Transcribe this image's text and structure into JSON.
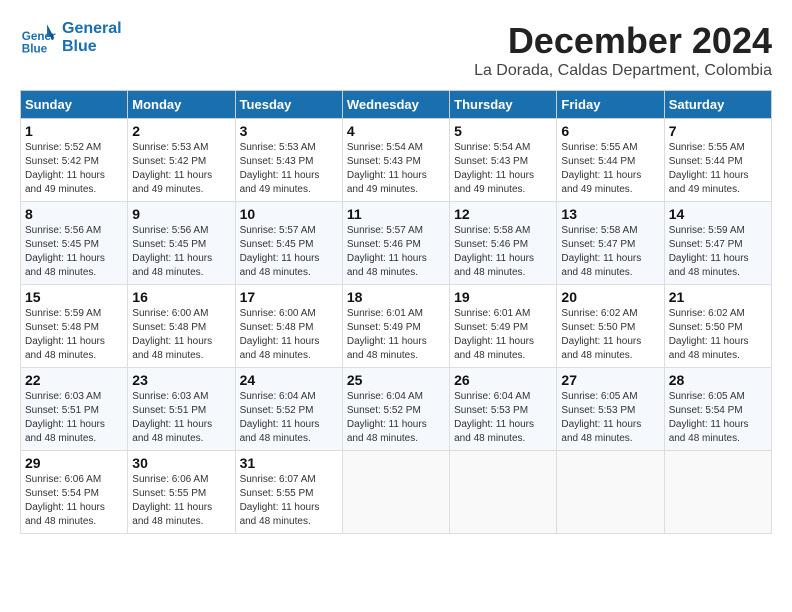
{
  "header": {
    "logo_line1": "General",
    "logo_line2": "Blue",
    "month": "December 2024",
    "location": "La Dorada, Caldas Department, Colombia"
  },
  "weekdays": [
    "Sunday",
    "Monday",
    "Tuesday",
    "Wednesday",
    "Thursday",
    "Friday",
    "Saturday"
  ],
  "weeks": [
    [
      {
        "day": "1",
        "sunrise": "5:52 AM",
        "sunset": "5:42 PM",
        "daylight": "11 hours and 49 minutes."
      },
      {
        "day": "2",
        "sunrise": "5:53 AM",
        "sunset": "5:42 PM",
        "daylight": "11 hours and 49 minutes."
      },
      {
        "day": "3",
        "sunrise": "5:53 AM",
        "sunset": "5:43 PM",
        "daylight": "11 hours and 49 minutes."
      },
      {
        "day": "4",
        "sunrise": "5:54 AM",
        "sunset": "5:43 PM",
        "daylight": "11 hours and 49 minutes."
      },
      {
        "day": "5",
        "sunrise": "5:54 AM",
        "sunset": "5:43 PM",
        "daylight": "11 hours and 49 minutes."
      },
      {
        "day": "6",
        "sunrise": "5:55 AM",
        "sunset": "5:44 PM",
        "daylight": "11 hours and 49 minutes."
      },
      {
        "day": "7",
        "sunrise": "5:55 AM",
        "sunset": "5:44 PM",
        "daylight": "11 hours and 49 minutes."
      }
    ],
    [
      {
        "day": "8",
        "sunrise": "5:56 AM",
        "sunset": "5:45 PM",
        "daylight": "11 hours and 48 minutes."
      },
      {
        "day": "9",
        "sunrise": "5:56 AM",
        "sunset": "5:45 PM",
        "daylight": "11 hours and 48 minutes."
      },
      {
        "day": "10",
        "sunrise": "5:57 AM",
        "sunset": "5:45 PM",
        "daylight": "11 hours and 48 minutes."
      },
      {
        "day": "11",
        "sunrise": "5:57 AM",
        "sunset": "5:46 PM",
        "daylight": "11 hours and 48 minutes."
      },
      {
        "day": "12",
        "sunrise": "5:58 AM",
        "sunset": "5:46 PM",
        "daylight": "11 hours and 48 minutes."
      },
      {
        "day": "13",
        "sunrise": "5:58 AM",
        "sunset": "5:47 PM",
        "daylight": "11 hours and 48 minutes."
      },
      {
        "day": "14",
        "sunrise": "5:59 AM",
        "sunset": "5:47 PM",
        "daylight": "11 hours and 48 minutes."
      }
    ],
    [
      {
        "day": "15",
        "sunrise": "5:59 AM",
        "sunset": "5:48 PM",
        "daylight": "11 hours and 48 minutes."
      },
      {
        "day": "16",
        "sunrise": "6:00 AM",
        "sunset": "5:48 PM",
        "daylight": "11 hours and 48 minutes."
      },
      {
        "day": "17",
        "sunrise": "6:00 AM",
        "sunset": "5:48 PM",
        "daylight": "11 hours and 48 minutes."
      },
      {
        "day": "18",
        "sunrise": "6:01 AM",
        "sunset": "5:49 PM",
        "daylight": "11 hours and 48 minutes."
      },
      {
        "day": "19",
        "sunrise": "6:01 AM",
        "sunset": "5:49 PM",
        "daylight": "11 hours and 48 minutes."
      },
      {
        "day": "20",
        "sunrise": "6:02 AM",
        "sunset": "5:50 PM",
        "daylight": "11 hours and 48 minutes."
      },
      {
        "day": "21",
        "sunrise": "6:02 AM",
        "sunset": "5:50 PM",
        "daylight": "11 hours and 48 minutes."
      }
    ],
    [
      {
        "day": "22",
        "sunrise": "6:03 AM",
        "sunset": "5:51 PM",
        "daylight": "11 hours and 48 minutes."
      },
      {
        "day": "23",
        "sunrise": "6:03 AM",
        "sunset": "5:51 PM",
        "daylight": "11 hours and 48 minutes."
      },
      {
        "day": "24",
        "sunrise": "6:04 AM",
        "sunset": "5:52 PM",
        "daylight": "11 hours and 48 minutes."
      },
      {
        "day": "25",
        "sunrise": "6:04 AM",
        "sunset": "5:52 PM",
        "daylight": "11 hours and 48 minutes."
      },
      {
        "day": "26",
        "sunrise": "6:04 AM",
        "sunset": "5:53 PM",
        "daylight": "11 hours and 48 minutes."
      },
      {
        "day": "27",
        "sunrise": "6:05 AM",
        "sunset": "5:53 PM",
        "daylight": "11 hours and 48 minutes."
      },
      {
        "day": "28",
        "sunrise": "6:05 AM",
        "sunset": "5:54 PM",
        "daylight": "11 hours and 48 minutes."
      }
    ],
    [
      {
        "day": "29",
        "sunrise": "6:06 AM",
        "sunset": "5:54 PM",
        "daylight": "11 hours and 48 minutes."
      },
      {
        "day": "30",
        "sunrise": "6:06 AM",
        "sunset": "5:55 PM",
        "daylight": "11 hours and 48 minutes."
      },
      {
        "day": "31",
        "sunrise": "6:07 AM",
        "sunset": "5:55 PM",
        "daylight": "11 hours and 48 minutes."
      },
      null,
      null,
      null,
      null
    ]
  ]
}
